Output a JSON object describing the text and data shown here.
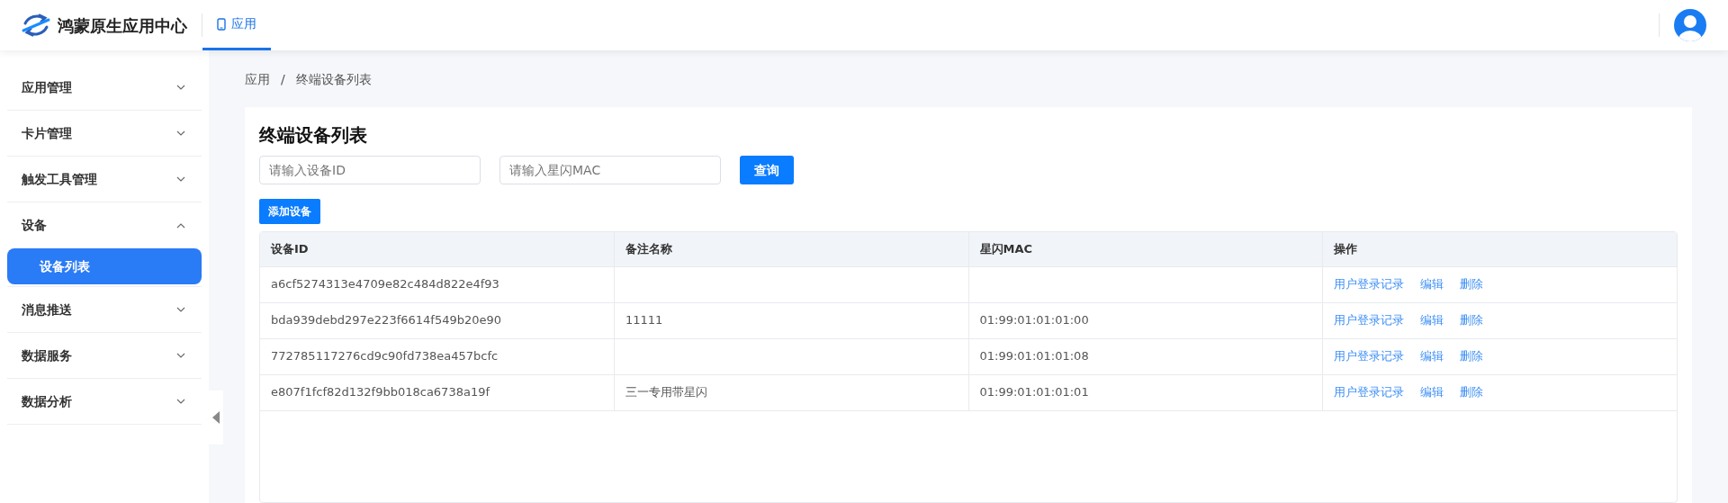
{
  "header": {
    "title": "鸿蒙原生应用中心",
    "tabs": [
      {
        "label": "应用",
        "selected": true
      }
    ]
  },
  "sidebar": {
    "items": [
      {
        "label": "应用管理",
        "expanded": false
      },
      {
        "label": "卡片管理",
        "expanded": false
      },
      {
        "label": "触发工具管理",
        "expanded": false
      },
      {
        "label": "设备",
        "expanded": true,
        "children": [
          {
            "label": "设备列表",
            "selected": true
          }
        ]
      },
      {
        "label": "消息推送",
        "expanded": false
      },
      {
        "label": "数据服务",
        "expanded": false
      },
      {
        "label": "数据分析",
        "expanded": false
      }
    ]
  },
  "breadcrumb": {
    "items": [
      "应用",
      "终端设备列表"
    ],
    "separator": "/"
  },
  "page_title": "终端设备列表",
  "filters": [
    {
      "placeholder": "请输入设备ID"
    },
    {
      "placeholder": "请输入星闪MAC"
    }
  ],
  "query_button": "查询",
  "add_button": "添加设备",
  "table": {
    "columns": [
      "设备ID",
      "备注名称",
      "星闪MAC",
      "操作"
    ],
    "rows": [
      {
        "device_id": "a6cf5274313e4709e82c484d822e4f93",
        "actions": [
          "用户登录记录",
          "编辑",
          "删除"
        ]
      },
      {
        "device_id": "bda939debd297e223f6614f549b20e90",
        "remark": "11111",
        "mac": "01:99:01:01:01:00",
        "actions": [
          "用户登录记录",
          "编辑",
          "删除"
        ]
      },
      {
        "device_id": "772785117276cd9c90fd738ea457bcfc",
        "mac": "01:99:01:01:01:08",
        "actions": [
          "用户登录记录",
          "编辑",
          "删除"
        ]
      },
      {
        "device_id": "e807f1fcf82d132f9bb018ca6738a19f",
        "remark": "三一专用带星闪",
        "mac": "01:99:01:01:01:01",
        "actions": [
          "用户登录记录",
          "编辑",
          "删除"
        ]
      }
    ]
  }
}
